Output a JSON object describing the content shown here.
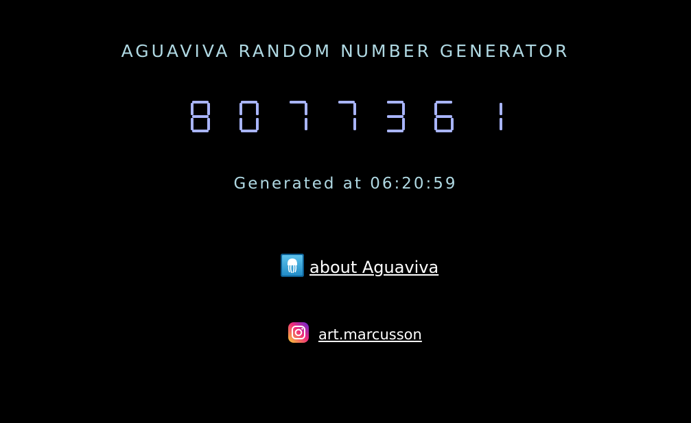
{
  "title": "AGUAVIVA RANDOM NUMBER GENERATOR",
  "number": {
    "digits": [
      "8",
      "0",
      "7",
      "7",
      "3",
      "6",
      "1"
    ],
    "color": "#a9b5ff"
  },
  "generated_text": "Generated at 06:20:59",
  "about": {
    "icon": "jellyfish-icon",
    "label": "about Aguaviva"
  },
  "instagram": {
    "icon": "instagram-icon",
    "label": "art.marcusson"
  },
  "colors": {
    "background": "#000000",
    "title": "#b0d9e3",
    "link": "#ffffff"
  }
}
